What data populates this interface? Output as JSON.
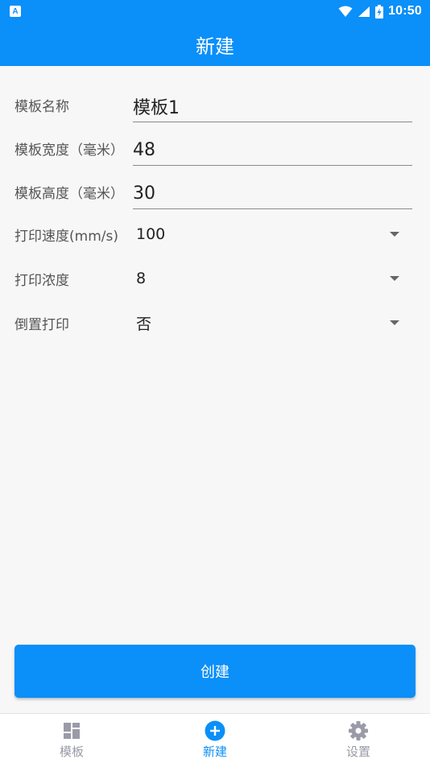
{
  "status_bar": {
    "time": "10:50",
    "notification_glyph": "A"
  },
  "app_bar": {
    "title": "新建"
  },
  "form": {
    "template_name": {
      "label": "模板名称",
      "value": "模板1"
    },
    "width": {
      "label": "模板宽度（毫米）",
      "value": "48"
    },
    "height": {
      "label": "模板高度（毫米）",
      "value": "30"
    },
    "print_speed": {
      "label": "打印速度(mm/s)",
      "value": "100"
    },
    "print_density": {
      "label": "打印浓度",
      "value": "8"
    },
    "inverted_print": {
      "label": "倒置打印",
      "value": "否"
    }
  },
  "create_button": {
    "label": "创建"
  },
  "bottom_nav": {
    "items": [
      {
        "label": "模板",
        "icon": "dashboard-icon",
        "active": false
      },
      {
        "label": "新建",
        "icon": "add-circle-icon",
        "active": true
      },
      {
        "label": "设置",
        "icon": "gear-icon",
        "active": false
      }
    ]
  },
  "colors": {
    "primary": "#0b8ff9",
    "inactive": "#9a9aa8",
    "background": "#f7f7f7"
  }
}
